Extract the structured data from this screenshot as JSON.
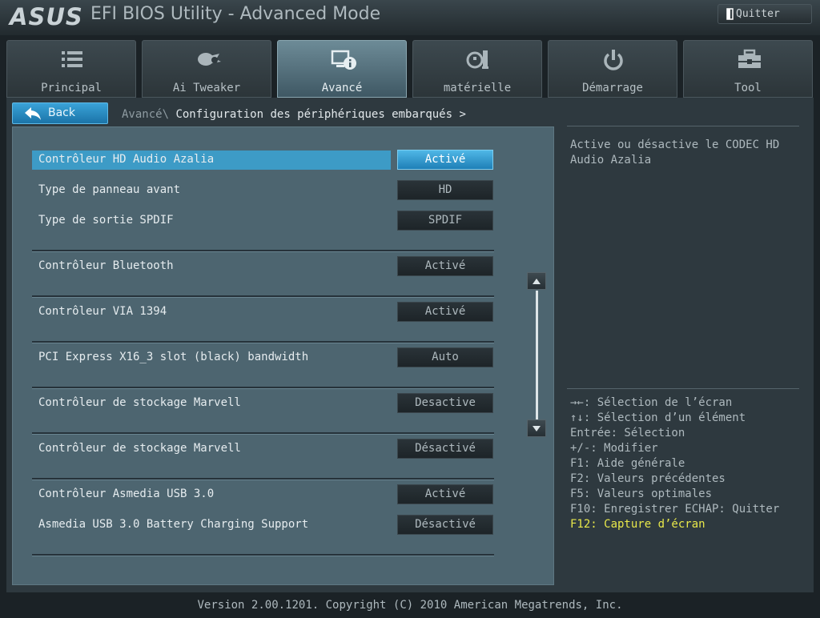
{
  "header": {
    "logo": "ASUS",
    "title": "EFI BIOS Utility - Advanced Mode",
    "quit_label": "Quitter"
  },
  "tabs": [
    {
      "label": "Principal",
      "icon": "list-icon"
    },
    {
      "label": "Ai Tweaker",
      "icon": "tweaker-icon"
    },
    {
      "label": "Avancé",
      "icon": "advanced-info-icon",
      "active": true
    },
    {
      "label": "matérielle",
      "icon": "monitor-icon"
    },
    {
      "label": "Démarrage",
      "icon": "power-icon"
    },
    {
      "label": "Tool",
      "icon": "toolbox-icon"
    }
  ],
  "nav": {
    "back_label": "Back",
    "breadcrumb_root": "Avancé\\",
    "breadcrumb_current": "Configuration des périphériques embarqués >"
  },
  "settings": [
    {
      "label": "Contrôleur HD Audio Azalia",
      "value": "Activé",
      "selected": true
    },
    {
      "label": "Type de panneau avant",
      "value": "HD"
    },
    {
      "label": "Type de sortie SPDIF",
      "value": "SPDIF"
    },
    {
      "label": "Contrôleur Bluetooth",
      "value": "Activé"
    },
    {
      "label": "Contrôleur VIA 1394",
      "value": "Activé"
    },
    {
      "label": "PCI Express X16_3 slot (black) bandwidth",
      "value": "Auto"
    },
    {
      "label": "Contrôleur de stockage Marvell",
      "value": "Desactive"
    },
    {
      "label": "Contrôleur de stockage Marvell",
      "value": "Désactivé"
    },
    {
      "label": "Contrôleur Asmedia USB 3.0",
      "value": "Activé"
    },
    {
      "label": "Asmedia USB 3.0 Battery Charging Support",
      "value": "Désactivé"
    }
  ],
  "help": {
    "description": "Active ou désactive le CODEC HD Audio Azalia"
  },
  "keys": [
    "→←: Sélection de l’écran",
    "↑↓: Sélection d’un élément",
    "Entrée: Sélection",
    "+/-: Modifier",
    "F1: Aide générale",
    "F2: Valeurs précédentes",
    "F5: Valeurs optimales",
    "F10: Enregistrer  ECHAP: Quitter",
    "F12: Capture d’écran"
  ],
  "footer": "Version 2.00.1201. Copyright (C) 2010 American Megatrends, Inc.",
  "colors": {
    "accent": "#3d9bc6",
    "highlight_key": "#e8e84a",
    "panel": "#4d6570"
  }
}
